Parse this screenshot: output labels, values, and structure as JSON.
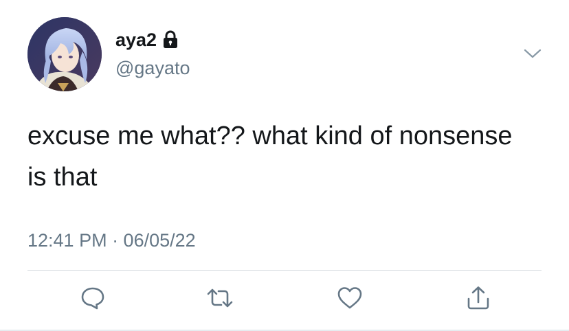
{
  "user": {
    "display_name": "aya2",
    "handle": "@gayato",
    "protected_icon": "lock-icon",
    "avatar_icon": "avatar"
  },
  "tweet": {
    "text": "excuse me what?? what kind of nonsense is that",
    "timestamp": "12:41 PM · 06/05/22"
  },
  "actions": [
    {
      "name": "reply",
      "icon": "comment-icon"
    },
    {
      "name": "retweet",
      "icon": "retweet-icon"
    },
    {
      "name": "like",
      "icon": "heart-icon"
    },
    {
      "name": "share",
      "icon": "share-icon"
    }
  ],
  "colors": {
    "text": "#14171a",
    "secondary": "#657786",
    "icon": "#657786",
    "divider": "#d6dbe0"
  }
}
